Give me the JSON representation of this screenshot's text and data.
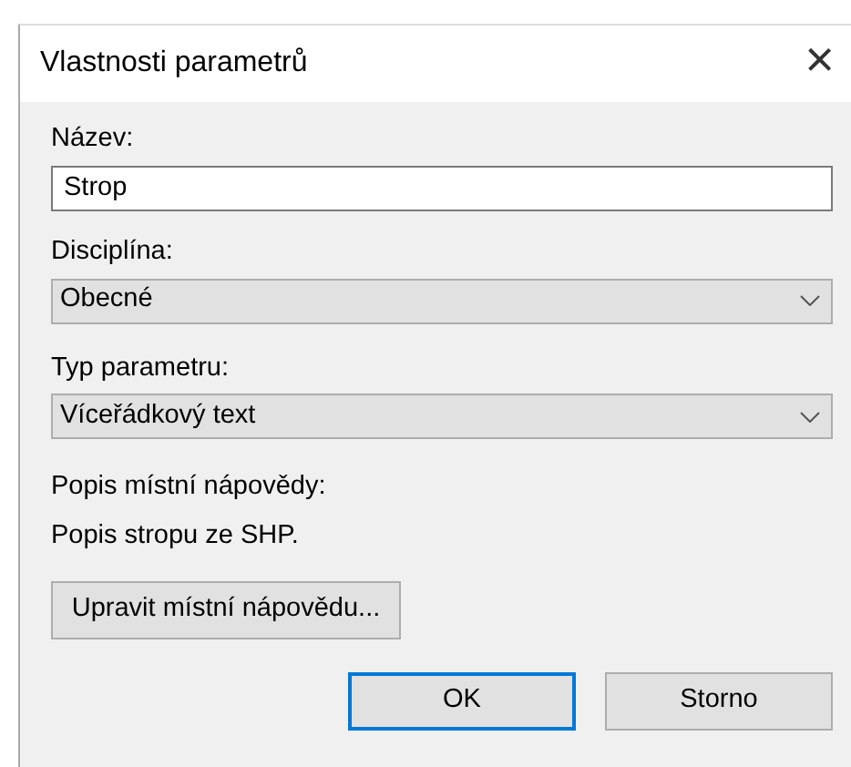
{
  "window": {
    "title": "Vlastnosti parametrů",
    "close": "×"
  },
  "fields": [
    {
      "kind": "input",
      "label": "Název:",
      "value": "Strop"
    },
    {
      "kind": "select",
      "label": "Disciplína:",
      "value": "Obecné"
    },
    {
      "kind": "select",
      "label": "Typ parametru:",
      "value": "Víceřádkový text"
    }
  ],
  "tooltip": {
    "label": "Popis místní nápovědy:",
    "text": "Popis stropu ze SHP.",
    "button": "Upravit místní nápovědu..."
  },
  "buttons": [
    {
      "label": "OK",
      "default": true
    },
    {
      "label": "Storno",
      "default": false
    }
  ]
}
